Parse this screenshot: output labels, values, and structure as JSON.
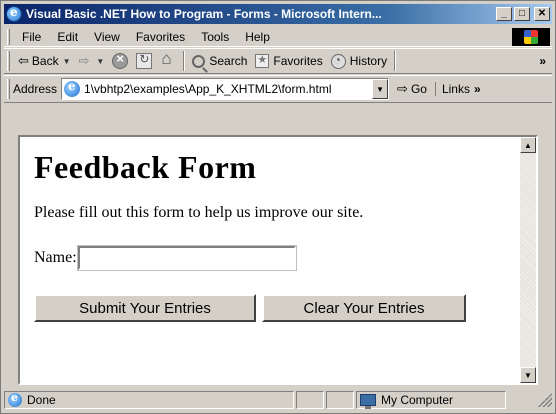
{
  "window": {
    "title": "Visual Basic .NET How to Program - Forms - Microsoft Intern...",
    "controls": {
      "minimize": "_",
      "maximize": "□",
      "close": "✕"
    }
  },
  "menubar": {
    "items": [
      "File",
      "Edit",
      "View",
      "Favorites",
      "Tools",
      "Help"
    ]
  },
  "toolbar": {
    "back_label": "Back",
    "back_glyph": "⇦",
    "forward_glyph": "⇨",
    "search_label": "Search",
    "favorites_label": "Favorites",
    "history_label": "History",
    "more": "»"
  },
  "address": {
    "label": "Address",
    "url": "1\\vbhtp2\\examples\\App_K_XHTML2\\form.html",
    "go_label": "Go",
    "links_label": "Links",
    "links_more": "»"
  },
  "page": {
    "heading": "Feedback Form",
    "intro": "Please fill out this form to help us improve our site.",
    "name_label": "Name:",
    "name_value": "",
    "submit_label": "Submit Your Entries",
    "clear_label": "Clear Your Entries"
  },
  "status": {
    "text": "Done",
    "zone": "My Computer"
  }
}
